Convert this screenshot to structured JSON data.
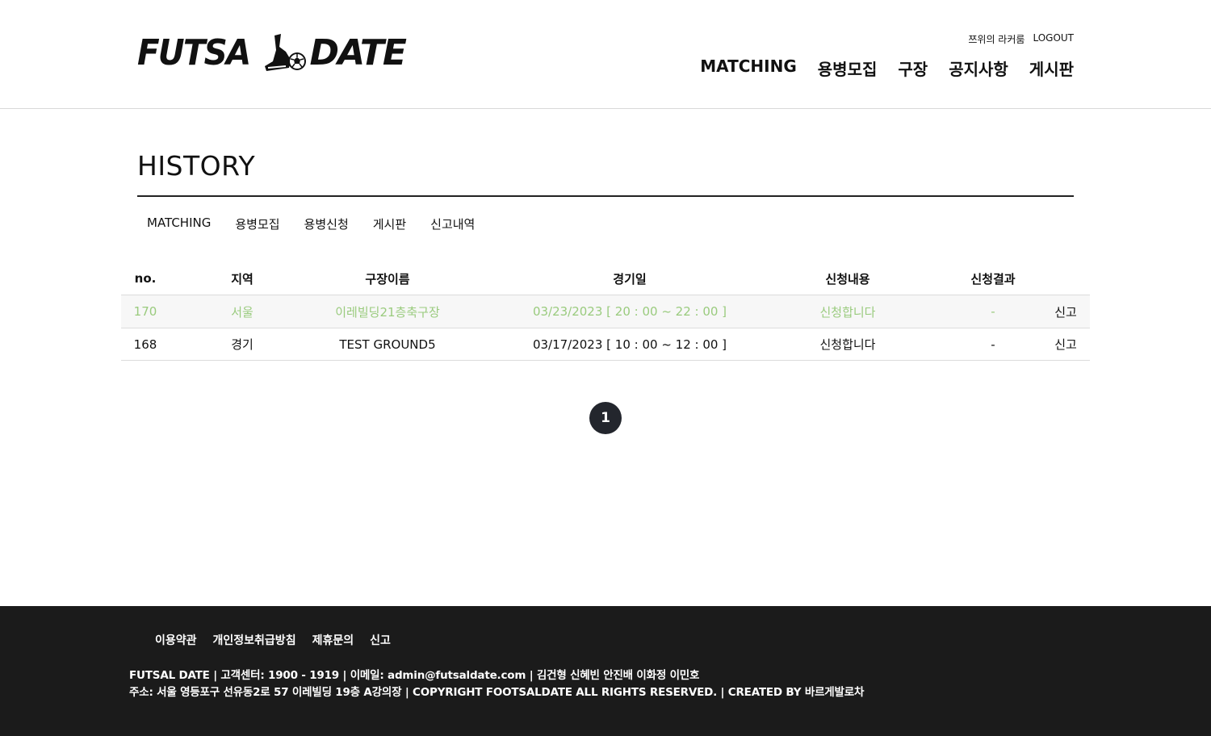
{
  "header": {
    "logo_left": "FUTSA",
    "logo_right": "DATE",
    "user_name": "쯔위의 라커룸",
    "logout_label": "LOGOUT",
    "nav": [
      "MATCHING",
      "용병모집",
      "구장",
      "공지사항",
      "게시판"
    ]
  },
  "page": {
    "title": "HISTORY",
    "subtabs": [
      "MATCHING",
      "용병모집",
      "용병신청",
      "게시판",
      "신고내역"
    ]
  },
  "table": {
    "headers": [
      "no.",
      "지역",
      "구장이름",
      "경기일",
      "신청내용",
      "신청결과"
    ],
    "rows": [
      {
        "no": "170",
        "region": "서울",
        "ground": "이레빌딩21층축구장",
        "date": "03/23/2023 [ 20 : 00 ~ 22 : 00 ]",
        "apply": "신청합니다",
        "result": "-",
        "report": "신고"
      },
      {
        "no": "168",
        "region": "경기",
        "ground": "TEST GROUND5",
        "date": "03/17/2023 [ 10 : 00 ~ 12 : 00 ]",
        "apply": "신청합니다",
        "result": "-",
        "report": "신고"
      }
    ],
    "highlight_color": "#9acb7e"
  },
  "pagination": {
    "current": "1"
  },
  "footer": {
    "links": [
      "이용약관",
      "개인정보취급방침",
      "제휴문의",
      "신고"
    ],
    "line1": "FUTSAL DATE | 고객센터: 1900 - 1919 | 이메일: admin@futsaldate.com | 김건형 신혜빈 안진배 이화정 이민호",
    "line2": "주소: 서울 영등포구 선유동2로 57 이레빌딩 19층 A강의장 | COPYRIGHT FOOTSALDATE ALL RIGHTS RESERVED. | CREATED BY 바르게발로차"
  }
}
